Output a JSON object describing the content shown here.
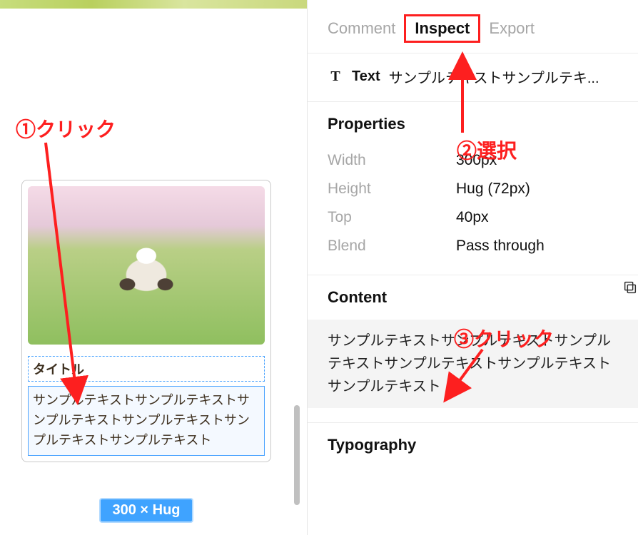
{
  "annotations": {
    "a1": "①クリック",
    "a2": "②選択",
    "a3": "③クリック"
  },
  "card": {
    "title": "タイトル",
    "sample_text": "サンプルテキストサンプルテキストサンプルテキストサンプルテキストサンプルテキストサンプルテキスト",
    "size_badge": "300 × Hug"
  },
  "panel": {
    "tabs": {
      "comment": "Comment",
      "inspect": "Inspect",
      "export": "Export"
    },
    "layer": {
      "label": "Text",
      "value": "サンプルテキストサンプルテキ..."
    },
    "properties": {
      "title": "Properties",
      "rows": [
        {
          "label": "Width",
          "value": "300px"
        },
        {
          "label": "Height",
          "value": "Hug (72px)"
        },
        {
          "label": "Top",
          "value": "40px"
        },
        {
          "label": "Blend",
          "value": "Pass through"
        }
      ]
    },
    "content": {
      "title": "Content",
      "text": "サンプルテキストサンプルテキストサンプルテキストサンプルテキストサンプルテキストサンプルテキスト"
    },
    "typography": {
      "title": "Typography"
    }
  }
}
